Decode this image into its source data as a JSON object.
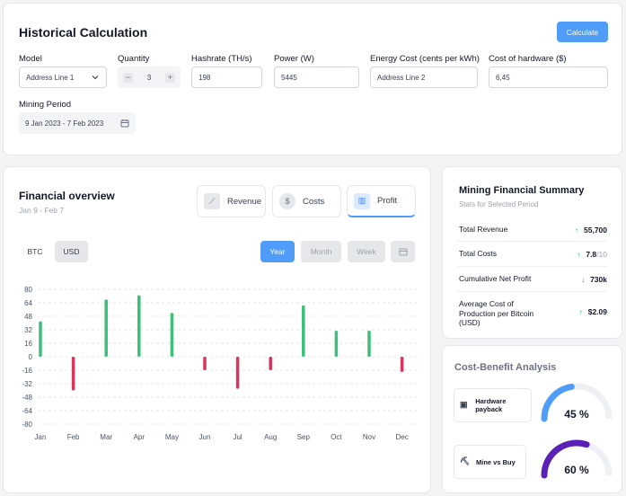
{
  "historical": {
    "title": "Historical Calculation",
    "calculate_label": "Calculate",
    "fields": {
      "model_label": "Model",
      "model_value": "Address Line 1",
      "quantity_label": "Quantity",
      "quantity_value": "3",
      "quantity_minus": "−",
      "quantity_plus": "+",
      "hashrate_label": "Hashrate (TH/s)",
      "hashrate_value": "198",
      "power_label": "Power (W)",
      "power_value": "5445",
      "energy_label": "Energy Cost (cents per kWh)",
      "energy_value": "Address Line 2",
      "hardware_label": "Cost of hardware ($)",
      "hardware_value": "6,45",
      "period_label": "Mining Period",
      "period_value": "9 Jan 2023 - 7 Feb 2023"
    }
  },
  "overview": {
    "title": "Financial overview",
    "subtitle": "Jan 9 - Feb 7",
    "tabs": [
      "Revenue",
      "Costs",
      "Profit"
    ],
    "currency": [
      "BTC",
      "USD"
    ],
    "ranges": [
      "Year",
      "Month",
      "Week"
    ]
  },
  "chart_data": {
    "type": "bar",
    "categories": [
      "Jan",
      "Feb",
      "Mar",
      "Apr",
      "May",
      "Jun",
      "Jul",
      "Aug",
      "Sep",
      "Oct",
      "Nov",
      "Dec"
    ],
    "values": [
      42,
      -40,
      68,
      73,
      52,
      -16,
      -38,
      -16,
      61,
      31,
      31,
      -18
    ],
    "ylim": [
      -80,
      80
    ],
    "yticks": [
      80,
      64,
      48,
      32,
      16,
      0,
      -16,
      -32,
      -48,
      -64,
      -80
    ],
    "grid": true,
    "colors": {
      "positive": "#3dbf7a",
      "negative": "#d9345a"
    }
  },
  "summary": {
    "title": "Mining Financial Summary",
    "subtitle": "Stats for Selected Period",
    "rows": [
      {
        "label": "Total Revenue",
        "value": "55,700",
        "suffix": "",
        "color": "#22c55e"
      },
      {
        "label": "Total Costs",
        "value": "7.8",
        "suffix": "/10",
        "color": "#22c55e"
      },
      {
        "label": "Cumulative Net Profit",
        "value": "730k",
        "suffix": "",
        "color": "#e11d48"
      },
      {
        "label": "Average Cost of Production per Bitcoin (USD)",
        "value": "$2.09",
        "suffix": "",
        "color": "#22c55e"
      }
    ]
  },
  "cba": {
    "title": "Cost-Benefit Analysis",
    "items": [
      {
        "label": "Hardware payback",
        "percent": "45 %",
        "level": 0.45,
        "color": "#4f9cf9"
      },
      {
        "label": "Mine vs Buy",
        "percent": "60 %",
        "level": 0.6,
        "color": "#5b21b6"
      }
    ]
  }
}
